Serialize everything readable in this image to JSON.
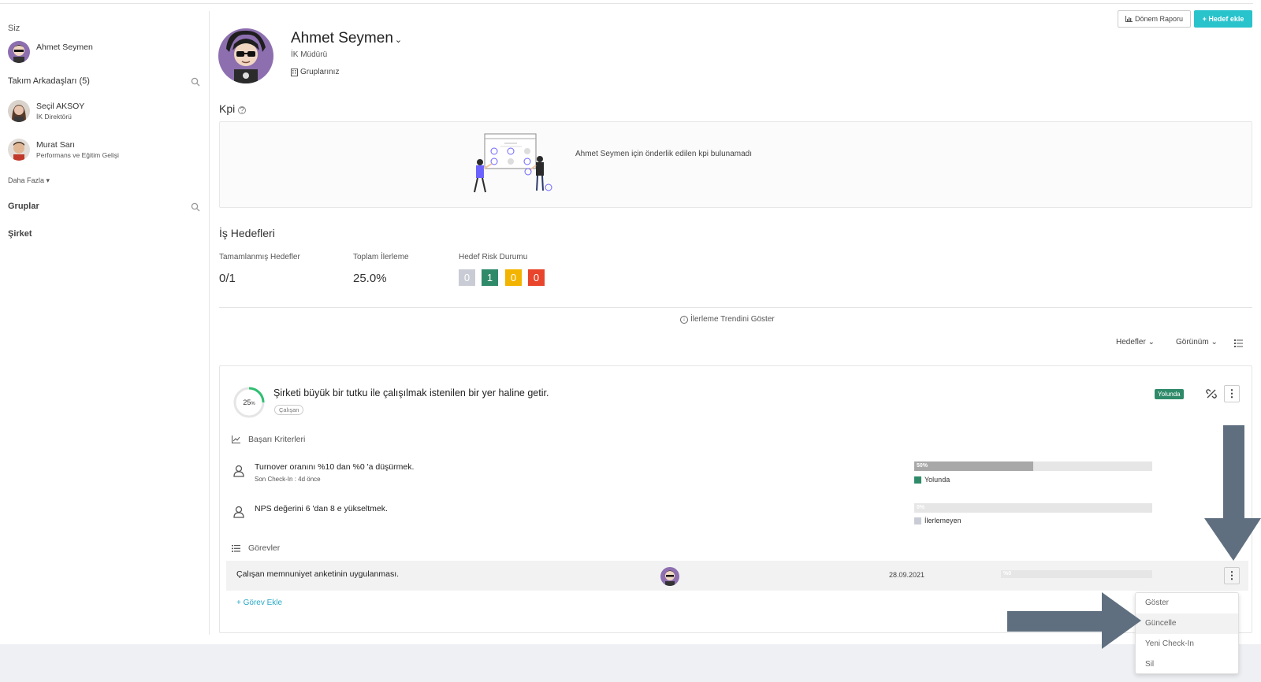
{
  "sidebar": {
    "you_heading": "Siz",
    "you_name": "Ahmet Seymen",
    "teammates_heading": "Takım Arkadaşları (5)",
    "teammates": [
      {
        "name": "Seçil AKSOY",
        "role": "İK Direktörü"
      },
      {
        "name": "Murat Sarı",
        "role": "Performans ve Eğitim Gelişi"
      }
    ],
    "more_label": "Daha Fazla",
    "groups_heading": "Gruplar",
    "company_heading": "Şirket"
  },
  "toolbar": {
    "report_label": "Dönem Raporu",
    "add_goal_label": "+ Hedef ekle"
  },
  "profile": {
    "name": "Ahmet Seymen",
    "role": "İK Müdürü",
    "groups_label": "Gruplarınız"
  },
  "kpi": {
    "title": "Kpi",
    "empty_message": "Ahmet Seymen için önderlik edilen kpi bulunamadı"
  },
  "goals": {
    "title": "İş Hedefleri",
    "completed_label": "Tamamlanmış Hedefler",
    "completed_value": "0/1",
    "progress_label": "Toplam İlerleme",
    "progress_value": "25.0%",
    "risk_label": "Hedef Risk Durumu",
    "risk_counts": [
      "0",
      "1",
      "0",
      "0"
    ],
    "risk_colors": [
      "#c9ccd4",
      "#2f8a6a",
      "#f3b400",
      "#e8452c"
    ],
    "trend_label": "İlerleme Trendini Göster",
    "filter_label": "Hedefler",
    "view_label": "Görünüm"
  },
  "goal_card": {
    "progress_percent": 25,
    "ring_label": "25",
    "title": "Şirketi büyük bir tutku ile çalışılmak istenilen bir yer haline getir.",
    "tag": "Çalışan",
    "status_badge": "Yolunda",
    "criteria_heading": "Başarı Kriterleri",
    "criteria": [
      {
        "title": "Turnover oranını %10 dan %0 'a düşürmek.",
        "sub": "Son Check-In : 4d önce",
        "bar_label": "50%",
        "progress": 0.5,
        "status": "Yolunda",
        "status_color": "#2f8a6a"
      },
      {
        "title": "NPS değerini 6 'dan 8 e yükseltmek.",
        "sub": "",
        "bar_label": "0%",
        "progress": 0,
        "status": "İlerlemeyen",
        "status_color": "#c9ccd4"
      }
    ],
    "tasks_heading": "Görevler",
    "task": {
      "title": "Çalışan memnuniyet anketinin uygulanması.",
      "date": "28.09.2021",
      "bar_label": "%0",
      "progress": 0
    },
    "add_task_label": "+ Görev Ekle"
  },
  "menu": {
    "items": [
      "Göster",
      "Güncelle",
      "Yeni Check-In",
      "Sil"
    ],
    "highlighted": "Güncelle"
  }
}
